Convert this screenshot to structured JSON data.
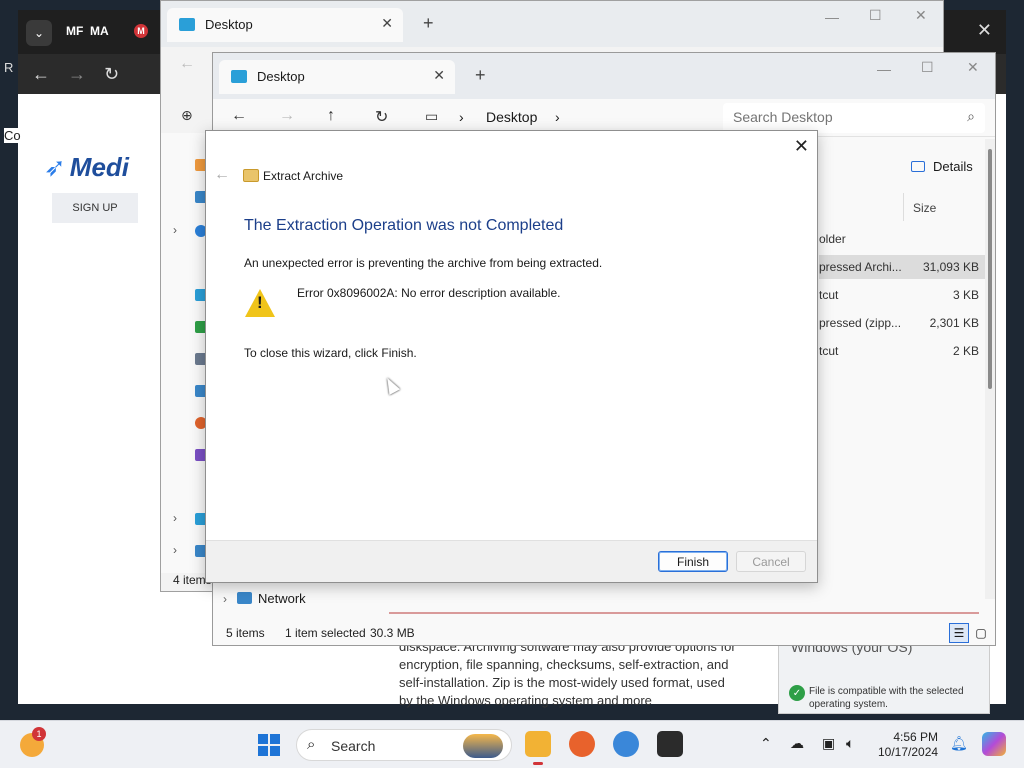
{
  "browser": {
    "tab_items": [
      "MF",
      "MA",
      "M"
    ],
    "side_chars": [
      "R",
      "Co"
    ],
    "site_logo": "Medi",
    "signup_label": "SIGN UP",
    "body_text": "diskspace. Archiving software may also provide options for encryption, file spanning, checksums, self-extraction, and self-installation. Zip is the most-widely used format, used by the Windows operating system and more",
    "compat_os": "Windows (your OS)",
    "compat_msg": "File is compatible with the selected operating system."
  },
  "explorer_back": {
    "tab_title": "Desktop",
    "item_count": "4 items"
  },
  "explorer_front": {
    "tab_title": "Desktop",
    "breadcrumb": "Desktop",
    "search_placeholder": "Search Desktop",
    "details_label": "Details",
    "size_header": "Size",
    "files": [
      {
        "name": "older",
        "size": ""
      },
      {
        "name": "pressed Archi...",
        "size": "31,093 KB",
        "selected": true
      },
      {
        "name": "tcut",
        "size": "3 KB"
      },
      {
        "name": "pressed (zipp...",
        "size": "2,301 KB"
      },
      {
        "name": "tcut",
        "size": "2 KB"
      }
    ],
    "network_label": "Network",
    "status_items": "5 items",
    "status_selected": "1 item selected",
    "status_size": "30.3 MB"
  },
  "dialog": {
    "title": "Extract Archive",
    "heading": "The Extraction Operation was not Completed",
    "message": "An unexpected error is preventing the archive from being extracted.",
    "error": "Error 0x8096002A: No error description available.",
    "instruction": "To close this wizard, click Finish.",
    "finish_label": "Finish",
    "cancel_label": "Cancel"
  },
  "taskbar": {
    "search_label": "Search",
    "weather_badge": "1",
    "time": "4:56 PM",
    "date": "10/17/2024"
  },
  "colors": {
    "accent": "#2a6fd8",
    "heading": "#1c3f8a",
    "warning": "#f0c419"
  },
  "icons": {
    "dialog": "folder-zip-icon",
    "warning": "warning-triangle-icon",
    "cursor": "mouse-pointer-icon"
  }
}
